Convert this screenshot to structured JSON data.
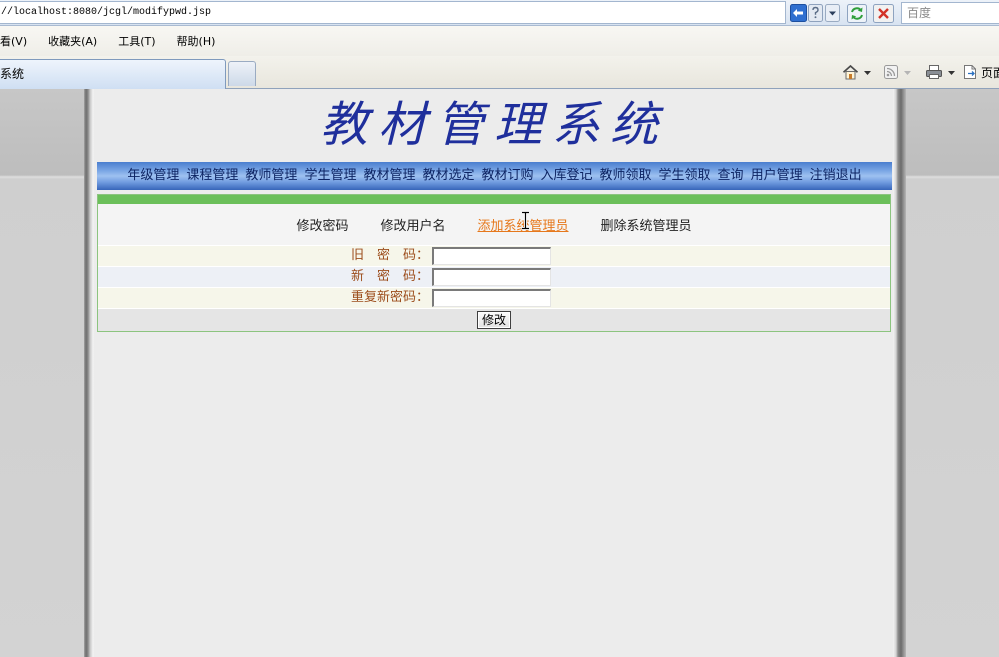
{
  "browser": {
    "address": "//localhost:8080/jcgl/modifypwd.jsp",
    "search_placeholder": "百度",
    "menu": [
      {
        "label": "看(V)"
      },
      {
        "label": "收藏夹(A)"
      },
      {
        "label": "工具(T)"
      },
      {
        "label": "帮助(H)"
      }
    ],
    "tab_title": "系统",
    "command_bar": {
      "page_label": "页面"
    },
    "icons": {
      "address_bar": [
        "compatibility-view-icon",
        "help-icon",
        "dropdown-arrow-icon",
        "refresh-icon",
        "stop-icon"
      ],
      "command_bar": [
        "home-icon",
        "dropdown-arrow-icon",
        "feeds-icon",
        "dropdown-arrow-icon",
        "print-icon",
        "dropdown-arrow-icon",
        "page-icon"
      ],
      "pointer": "text-cursor-icon"
    }
  },
  "page": {
    "title": "教材管理系统",
    "nav": [
      "年级管理",
      "课程管理",
      "教师管理",
      "学生管理",
      "教材管理",
      "教材选定",
      "教材订购",
      "入库登记",
      "教师领取",
      "学生领取",
      "查询",
      "用户管理",
      "注销退出"
    ],
    "account_links": [
      {
        "label": "修改密码",
        "hovered": false
      },
      {
        "label": "修改用户名",
        "hovered": false
      },
      {
        "label": "添加系统管理员",
        "hovered": true
      },
      {
        "label": "删除系统管理员",
        "hovered": false
      }
    ],
    "form": {
      "fields": [
        {
          "label": "旧　密　码：",
          "value": ""
        },
        {
          "label": "新　密　码：",
          "value": ""
        },
        {
          "label": "重复新密码：",
          "value": ""
        }
      ],
      "submit_label": "修改"
    }
  },
  "colors": {
    "title": "#1f2f9c",
    "nav_bar": "#78a4e4",
    "nav_text": "#0d2463",
    "accent_green": "#6bbf5a",
    "link_hover": "#e6781c",
    "form_label": "#9c4d1c"
  }
}
